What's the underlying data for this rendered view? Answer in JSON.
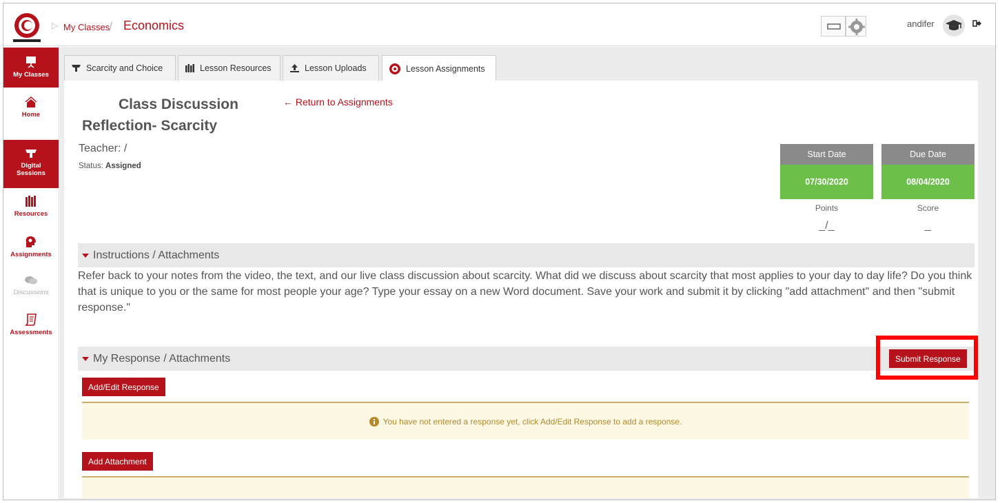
{
  "header": {
    "breadcrumb_root": "My Classes",
    "breadcrumb_sep": "/",
    "class_title": "Economics",
    "user_name": "andifer"
  },
  "sidebar": {
    "items": [
      {
        "label": "My Classes",
        "icon": "presentation-icon"
      },
      {
        "label": "Home",
        "icon": "home-icon"
      },
      {
        "label": "Digital Sessions",
        "icon": "lectern-icon"
      },
      {
        "label": "Resources",
        "icon": "books-icon"
      },
      {
        "label": "Assignments",
        "icon": "head-gears-icon"
      },
      {
        "label": "Discussions",
        "icon": "chat-icon"
      },
      {
        "label": "Assessments",
        "icon": "scroll-icon"
      }
    ]
  },
  "tabs": [
    {
      "label": "Scarcity and Choice",
      "icon": "lectern-icon"
    },
    {
      "label": "Lesson Resources",
      "icon": "books-icon"
    },
    {
      "label": "Lesson Uploads",
      "icon": "upload-icon"
    },
    {
      "label": "Lesson Assignments",
      "icon": "head-gears-icon",
      "active": true
    }
  ],
  "assignment": {
    "title_line1": "Class Discussion",
    "title_line2": "Reflection- Scarcity",
    "return_link": "Return to Assignments",
    "teacher_label": "Teacher: /",
    "status_label": "Status:",
    "status_value": "Assigned",
    "start_date_label": "Start Date",
    "start_date": "07/30/2020",
    "due_date_label": "Due Date",
    "due_date": "08/04/2020",
    "points_label": "Points",
    "points_value": "_/_",
    "score_label": "Score",
    "score_value": "_"
  },
  "instructions": {
    "header": "Instructions / Attachments",
    "text": "Refer back to your notes from the video, the text, and our live class discussion about scarcity.  What did we discuss about scarcity that most applies to your day to day life? Do you think that is unique to you or the same for most people your age? Type your essay on a new Word document. Save your work and submit it by clicking \"add attachment\" and then \"submit response.\""
  },
  "response": {
    "header": "My Response / Attachments",
    "submit_label": "Submit Response",
    "add_edit_label": "Add/Edit Response",
    "empty_notice": "You have not entered a response yet, click Add/Edit Response to add a response.",
    "add_attachment_label": "Add Attachment"
  },
  "colors": {
    "brand_red": "#b5121b",
    "date_green": "#6cc04a",
    "date_header_gray": "#8a8a8a",
    "notice_bg": "#fcf8e3",
    "highlight_red": "#ff0000"
  }
}
